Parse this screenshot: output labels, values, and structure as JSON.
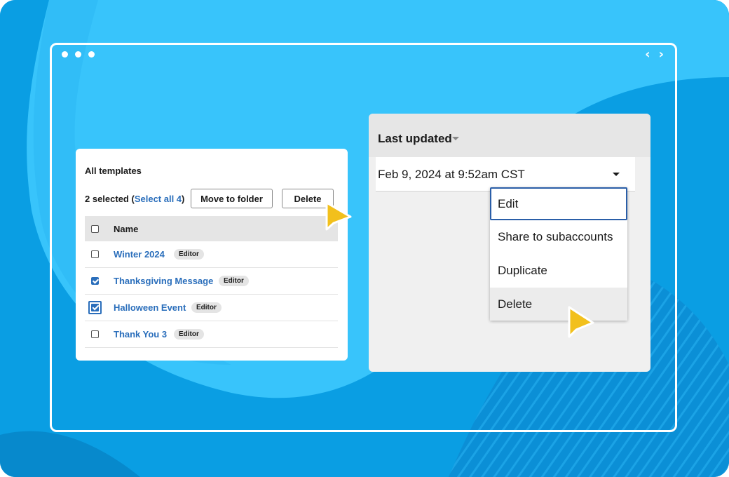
{
  "window": {
    "nav": {
      "back_icon": "‹",
      "forward_icon": "›"
    }
  },
  "templates_panel": {
    "title": "All templates",
    "selected_prefix": "2 selected (",
    "select_all_link": "Select all 4",
    "selected_suffix": ")",
    "move_button": "Move to folder",
    "delete_button": "Delete",
    "column_header": "Name",
    "rows": [
      {
        "name": "Winter 2024",
        "badge": "Editor",
        "checked": false
      },
      {
        "name": "Thanksgiving Message",
        "badge": "Editor",
        "checked": true
      },
      {
        "name": "Halloween Event",
        "badge": "Editor",
        "checked": true
      },
      {
        "name": "Thank You 3",
        "badge": "Editor",
        "checked": false
      }
    ]
  },
  "details_panel": {
    "header": "Last updated",
    "date": "Feb 9, 2024 at 9:52am CST",
    "menu": {
      "edit": "Edit",
      "share": "Share to subaccounts",
      "duplicate": "Duplicate",
      "delete": "Delete"
    }
  },
  "colors": {
    "background": "#0a9ee3",
    "accent_link": "#2a6ebb",
    "cursor": "#f2c01c"
  }
}
